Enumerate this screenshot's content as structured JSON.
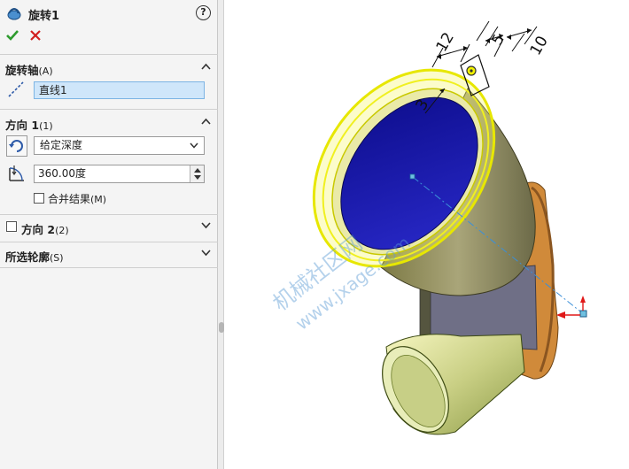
{
  "feature": {
    "title": "旋转1",
    "help": "?"
  },
  "sections": {
    "axis": {
      "title": "旋转轴",
      "key": "(A)",
      "value": "直线1"
    },
    "direction1": {
      "title": "方向 1",
      "key": "(1)",
      "end_condition": "给定深度",
      "angle": "360.00度",
      "merge_label": "合并结果",
      "merge_key": "(M)"
    },
    "direction2": {
      "title": "方向 2",
      "key": "(2)"
    },
    "contours": {
      "title": "所选轮廓",
      "key": "(S)"
    }
  },
  "dimensions": {
    "d12": "12",
    "d5": "5",
    "d10": "10",
    "d3": "3"
  },
  "watermark": {
    "line1": "机械社区网",
    "line2": "www.jxage.com"
  },
  "colors": {
    "panel_bg": "#f4f4f4",
    "selected_field": "#cfe6fa",
    "ok": "#2e9b2e",
    "cancel": "#d21f1f",
    "inner_blue": "#1818a8",
    "olive_surface": "#8f8b5a",
    "highlight_yellow": "#f4f400",
    "flange_orange": "#d08a3a"
  },
  "icons": [
    "revolve-feature-icon",
    "help-icon",
    "ok-check-icon",
    "cancel-x-icon",
    "axis-line-icon",
    "reverse-direction-icon",
    "angle-depth-icon",
    "chevron-up-icon",
    "chevron-down-icon"
  ]
}
